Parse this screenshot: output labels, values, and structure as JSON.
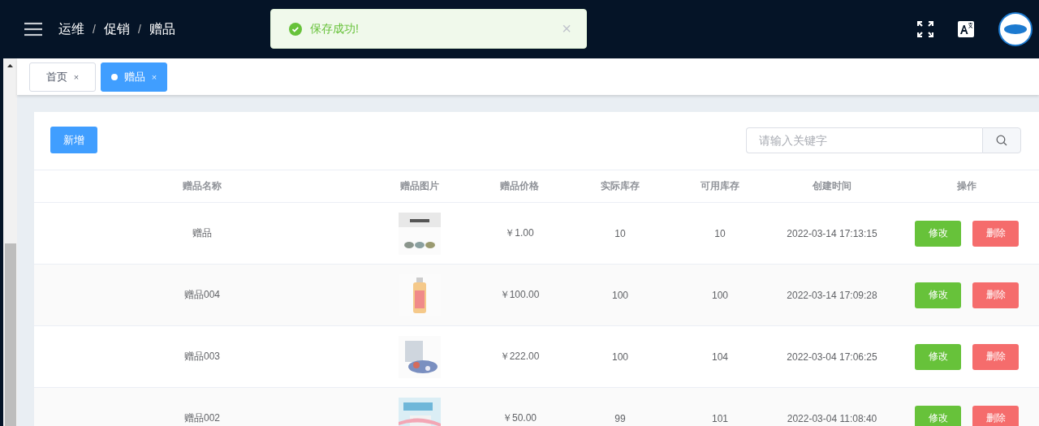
{
  "header": {
    "breadcrumb": [
      "运维",
      "促销",
      "赠品"
    ],
    "separator": "/"
  },
  "toast": {
    "kind": "success",
    "message": "保存成功!",
    "close": "×"
  },
  "tabs": [
    {
      "label": "首页",
      "close": "×",
      "selected": false
    },
    {
      "label": "赠品",
      "close": "×",
      "selected": true
    }
  ],
  "toolbar": {
    "add_button": "新增",
    "search": {
      "placeholder": "请输入关键字"
    }
  },
  "table": {
    "columns": [
      "赠品名称",
      "赠品图片",
      "赠品价格",
      "实际库存",
      "可用库存",
      "创建时间",
      "操作"
    ],
    "rows": [
      {
        "name": "赠品",
        "price": "￥1.00",
        "actual": "10",
        "available": "10",
        "created": "2022-03-14 17:13:15",
        "edit": "修改",
        "delete": "删除"
      },
      {
        "name": "赠品004",
        "price": "￥100.00",
        "actual": "100",
        "available": "100",
        "created": "2022-03-14 17:09:28",
        "edit": "修改",
        "delete": "删除"
      },
      {
        "name": "赠品003",
        "price": "￥222.00",
        "actual": "100",
        "available": "104",
        "created": "2022-03-04 17:06:25",
        "edit": "修改",
        "delete": "删除"
      },
      {
        "name": "赠品002",
        "price": "￥50.00",
        "actual": "99",
        "available": "101",
        "created": "2022-03-04 11:08:40",
        "edit": "修改",
        "delete": "删除"
      }
    ]
  }
}
